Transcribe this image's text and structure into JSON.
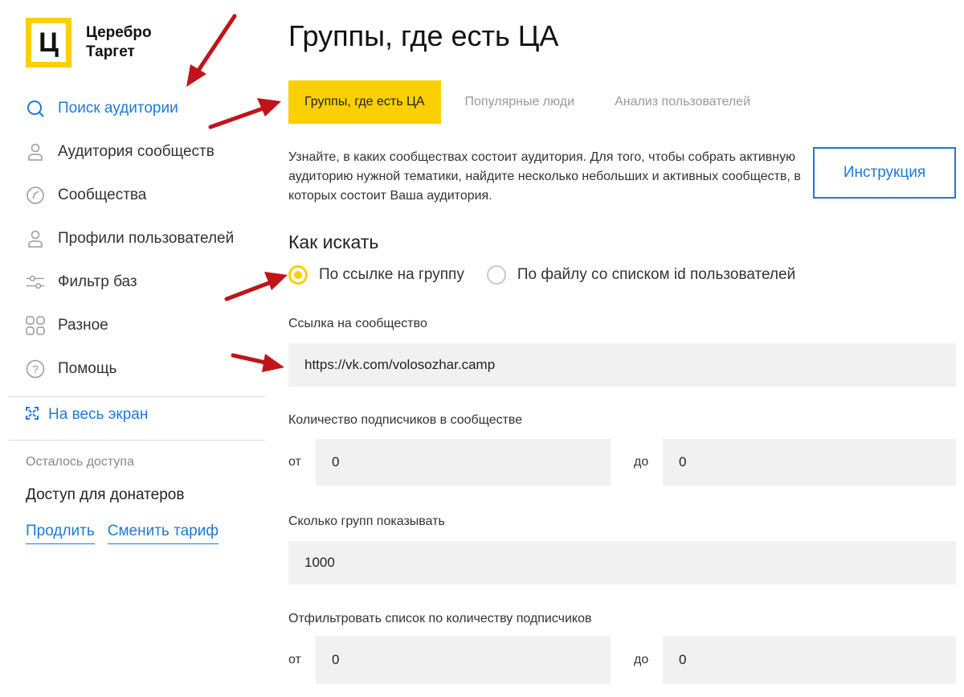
{
  "brand": {
    "logo_letter": "Ц",
    "name_line1": "Церебро",
    "name_line2": "Таргет",
    "accent_color": "#fad000",
    "link_color": "#1e7ad6"
  },
  "sidebar": {
    "items": [
      {
        "label": "Поиск аудитории",
        "icon": "search-icon",
        "active": true
      },
      {
        "label": "Аудитория сообществ",
        "icon": "user-icon"
      },
      {
        "label": "Сообщества",
        "icon": "compass-icon"
      },
      {
        "label": "Профили пользователей",
        "icon": "user-icon"
      },
      {
        "label": "Фильтр баз",
        "icon": "sliders-icon"
      },
      {
        "label": "Разное",
        "icon": "grid-icon"
      },
      {
        "label": "Помощь",
        "icon": "help-icon"
      }
    ],
    "fullscreen_label": "На весь экран",
    "access_left_label": "Осталось доступа",
    "access_plan": "Доступ для донатеров",
    "extend_link": "Продлить",
    "change_plan_link": "Сменить тариф"
  },
  "main": {
    "title": "Группы, где есть ЦА",
    "tabs": [
      {
        "label": "Группы, где есть ЦА",
        "active": true
      },
      {
        "label": "Популярные люди"
      },
      {
        "label": "Анализ пользователей"
      }
    ],
    "description": "Узнайте, в каких сообществах состоит аудитория. Для того, чтобы собрать активную аудиторию нужной тематики, найдите несколько небольших и активных сообществ, в которых состоит Ваша аудитория.",
    "instruction_button": "Инструкция",
    "how_to_search_title": "Как искать",
    "search_options": [
      {
        "label": "По ссылке на группу",
        "checked": true
      },
      {
        "label": "По файлу со списком id пользователей",
        "checked": false
      }
    ],
    "community_link_label": "Ссылка на сообщество",
    "community_link_value": "https://vk.com/volosozhar.camp",
    "subscribers_label": "Количество подписчиков в сообществе",
    "from_label": "от",
    "to_label": "до",
    "subscribers_from": "0",
    "subscribers_to": "0",
    "groups_count_label": "Сколько групп показывать",
    "groups_count_value": "1000",
    "filter_label": "Отфильтровать список по количеству подписчиков",
    "filter_from": "0",
    "filter_to": "0"
  },
  "annotation_color": "#c0141a"
}
